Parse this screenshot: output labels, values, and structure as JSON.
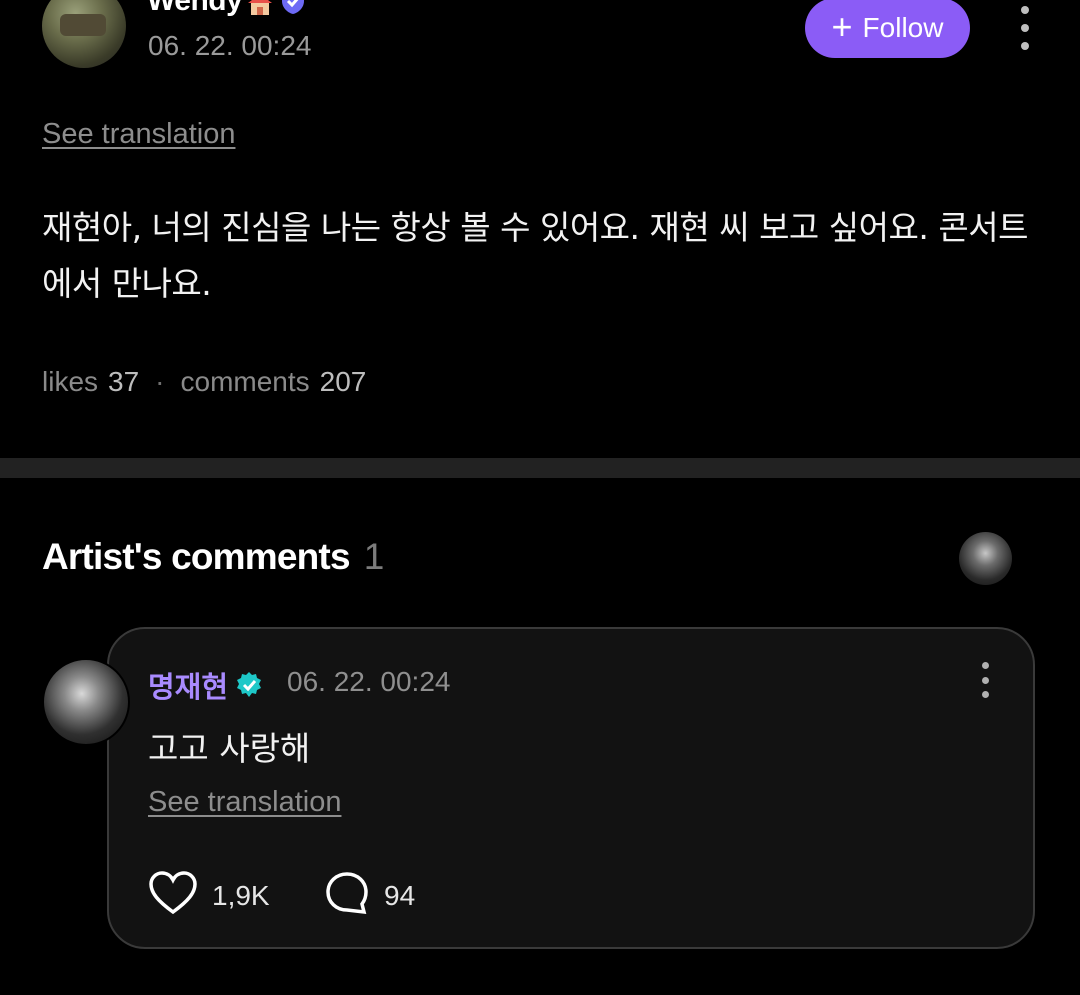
{
  "post": {
    "author": "Wendy",
    "timestamp": "06. 22. 00:24",
    "follow_label": "Follow",
    "see_translation": "See translation",
    "body": "재현아, 너의 진심을 나는 항상 볼 수 있어요. 재현 씨 보고 싶어요. 콘서트에서 만나요.",
    "likes_label": "likes",
    "likes_count": "37",
    "comments_label": "comments",
    "comments_count": "207",
    "accent_color": "#8b5cf6"
  },
  "artist_comments": {
    "heading": "Artist's comments",
    "count": "1"
  },
  "comment": {
    "author": "명재현",
    "timestamp": "06. 22. 00:24",
    "text": "고고 사랑해",
    "see_translation": "See translation",
    "likes": "1,9K",
    "replies": "94",
    "name_color": "#a98bff",
    "verified_color": "#1ec8c8"
  },
  "icons": [
    "house-icon",
    "shield-badge-icon",
    "plus-icon",
    "more-vertical-icon",
    "verified-icon",
    "heart-icon",
    "comment-bubble-icon"
  ]
}
